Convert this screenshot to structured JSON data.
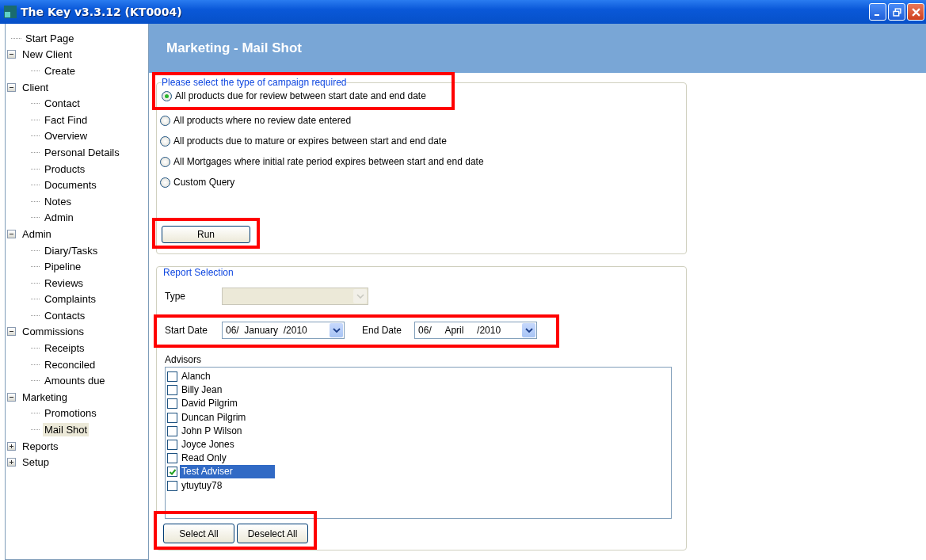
{
  "window": {
    "title": "The Key v3.3.12 (KT0004)"
  },
  "sidebar": {
    "items": [
      {
        "label": "Start Page",
        "selected": false
      },
      {
        "label": "New Client",
        "expanded": true,
        "selected": false,
        "children": [
          {
            "label": "Create",
            "selected": false
          }
        ]
      },
      {
        "label": "Client",
        "expanded": true,
        "selected": false,
        "children": [
          {
            "label": "Contact",
            "selected": false
          },
          {
            "label": "Fact Find",
            "selected": false
          },
          {
            "label": "Overview",
            "selected": false
          },
          {
            "label": "Personal Details",
            "selected": false
          },
          {
            "label": "Products",
            "selected": false
          },
          {
            "label": "Documents",
            "selected": false
          },
          {
            "label": "Notes",
            "selected": false
          },
          {
            "label": "Admin",
            "selected": false
          }
        ]
      },
      {
        "label": "Admin",
        "expanded": true,
        "selected": false,
        "children": [
          {
            "label": "Diary/Tasks",
            "selected": false
          },
          {
            "label": "Pipeline",
            "selected": false
          },
          {
            "label": "Reviews",
            "selected": false
          },
          {
            "label": "Complaints",
            "selected": false
          },
          {
            "label": "Contacts",
            "selected": false
          }
        ]
      },
      {
        "label": "Commissions",
        "expanded": true,
        "selected": false,
        "children": [
          {
            "label": "Receipts",
            "selected": false
          },
          {
            "label": "Reconciled",
            "selected": false
          },
          {
            "label": "Amounts due",
            "selected": false
          }
        ]
      },
      {
        "label": "Marketing",
        "expanded": true,
        "selected": false,
        "children": [
          {
            "label": "Promotions",
            "selected": false
          },
          {
            "label": "Mail Shot",
            "selected": true
          }
        ]
      },
      {
        "label": "Reports",
        "expanded": false,
        "selected": false
      },
      {
        "label": "Setup",
        "expanded": false,
        "selected": false
      }
    ]
  },
  "header": {
    "title": "Marketing - Mail Shot"
  },
  "campaign": {
    "legend": "Please select the type of campaign required",
    "highlighted": true,
    "options": [
      {
        "label": "All products due for review between start date and end date",
        "selected": true
      },
      {
        "label": "All products where no review date entered",
        "selected": false
      },
      {
        "label": "All products due to mature or expires between start and end date",
        "selected": false
      },
      {
        "label": "All Mortgages where initial rate period expires between start and end date",
        "selected": false
      },
      {
        "label": "Custom Query",
        "selected": false
      }
    ],
    "run_button": {
      "label": "Run",
      "highlighted": true
    }
  },
  "report_selection": {
    "legend": "Report Selection",
    "type_label": "Type",
    "type_disabled": true,
    "dates_highlighted": true,
    "start_label": "Start Date",
    "start_date": {
      "day": "06/",
      "month": "January",
      "year": "/2010"
    },
    "end_label": "End Date",
    "end_date": {
      "day": "06/",
      "month": "April",
      "year": "/2010"
    },
    "advisors_label": "Advisors",
    "advisors": [
      {
        "name": "Alanch",
        "checked": false,
        "selected": false
      },
      {
        "name": "Billy Jean",
        "checked": false,
        "selected": false
      },
      {
        "name": "David Pilgrim",
        "checked": false,
        "selected": false
      },
      {
        "name": "Duncan Pilgrim",
        "checked": false,
        "selected": false
      },
      {
        "name": "John P Wilson",
        "checked": false,
        "selected": false
      },
      {
        "name": "Joyce Jones",
        "checked": false,
        "selected": false
      },
      {
        "name": "Read Only",
        "checked": false,
        "selected": false
      },
      {
        "name": "Test Adviser",
        "checked": true,
        "selected": true
      },
      {
        "name": "ytuytuy78",
        "checked": false,
        "selected": false
      }
    ],
    "buttons_highlighted": true,
    "buttons": [
      "Select All",
      "Deselect All"
    ]
  }
}
